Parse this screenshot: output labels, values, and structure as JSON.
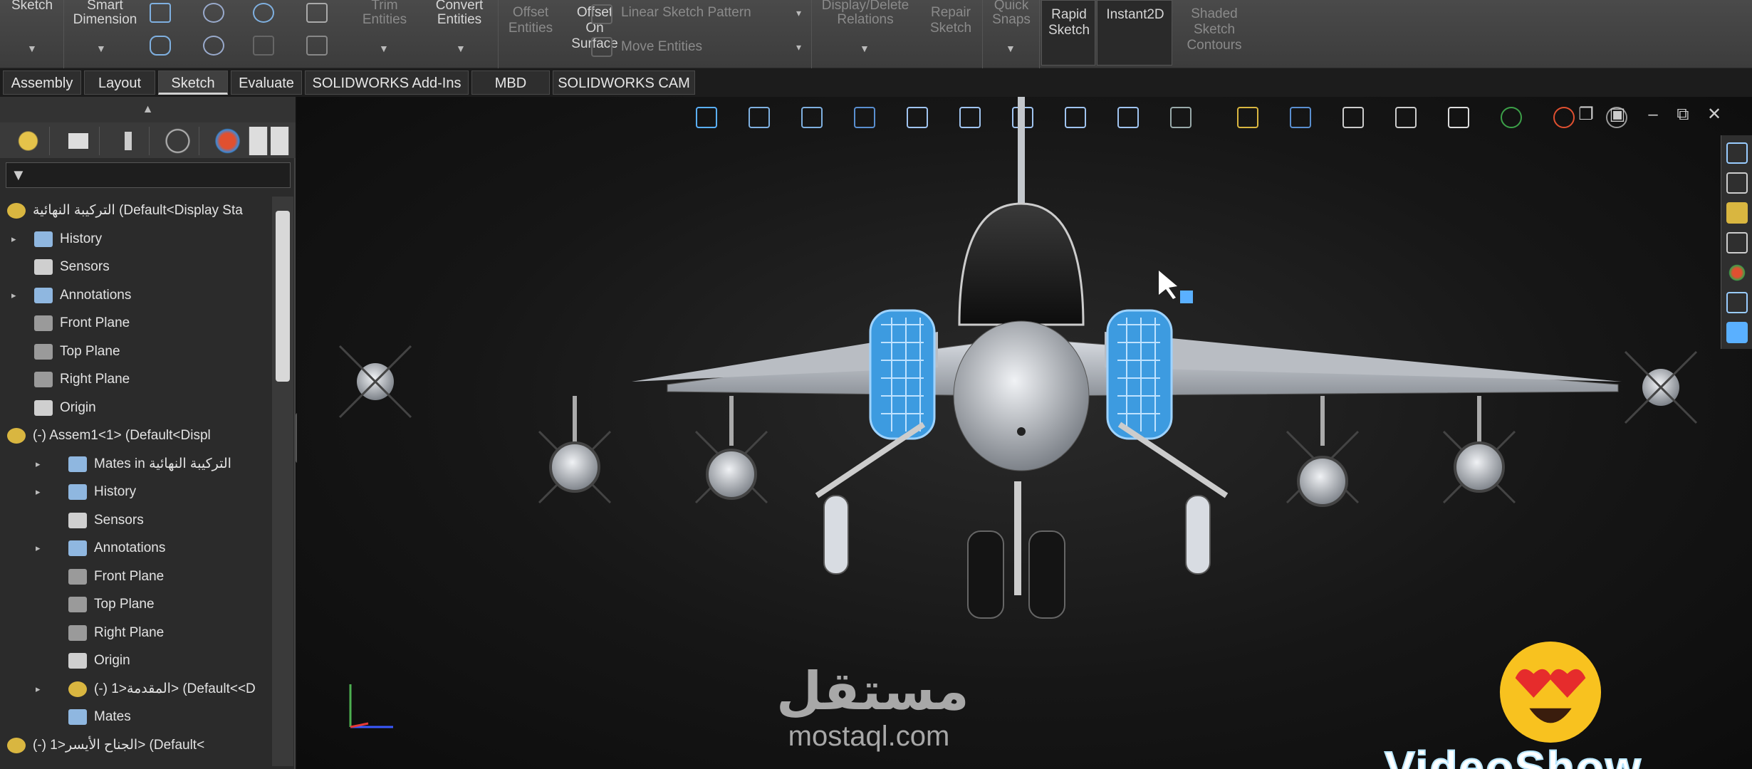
{
  "ribbon": {
    "groups": [
      {
        "label_1": "Sketch",
        "label_2": ""
      },
      {
        "label_1": "Smart",
        "label_2": "Dimension"
      },
      {
        "label_1": "Trim",
        "label_2": "Entities"
      },
      {
        "label_1": "Convert",
        "label_2": "Entities"
      },
      {
        "label_1": "Offset",
        "label_2": "Entities"
      },
      {
        "label_1": "Offset",
        "label_2": "On",
        "label_3": "Surface"
      }
    ],
    "linear_sketch_pattern": "Linear Sketch Pattern",
    "move_entities": "Move Entities",
    "display_delete_relations": "Display/Delete",
    "relations": "Relations",
    "repair_sketch_1": "Repair",
    "repair_sketch_2": "Sketch",
    "quick_snaps_1": "Quick",
    "quick_snaps_2": "Snaps",
    "rapid_sketch_1": "Rapid",
    "rapid_sketch_2": "Sketch",
    "instant2d": "Instant2D",
    "shaded_1": "Shaded",
    "shaded_2": "Sketch",
    "shaded_3": "Contours"
  },
  "tabs": [
    "Assembly",
    "Layout",
    "Sketch",
    "Evaluate",
    "SOLIDWORKS Add-Ins",
    "MBD",
    "SOLIDWORKS CAM"
  ],
  "active_tab": "Sketch",
  "panel": {
    "collapse_glyph": "▲",
    "tree": [
      {
        "indent": 0,
        "expander": "",
        "icon": "assembly-icon",
        "label": "التركيبة النهائية (Default<Display Sta",
        "color": "#d9b640"
      },
      {
        "indent": 1,
        "expander": "▸",
        "icon": "history-icon",
        "label": "History",
        "color": "#8fb7e0"
      },
      {
        "indent": 1,
        "expander": "",
        "icon": "sensors-icon",
        "label": "Sensors",
        "color": "#cfcfcf"
      },
      {
        "indent": 1,
        "expander": "▸",
        "icon": "annotations-icon",
        "label": "Annotations",
        "color": "#8fb7e0"
      },
      {
        "indent": 1,
        "expander": "",
        "icon": "plane-icon",
        "label": "Front Plane",
        "color": "#9a9a9a"
      },
      {
        "indent": 1,
        "expander": "",
        "icon": "plane-icon",
        "label": "Top Plane",
        "color": "#9a9a9a"
      },
      {
        "indent": 1,
        "expander": "",
        "icon": "plane-icon",
        "label": "Right Plane",
        "color": "#9a9a9a"
      },
      {
        "indent": 1,
        "expander": "",
        "icon": "origin-icon",
        "label": "Origin",
        "color": "#cfcfcf"
      },
      {
        "indent": 0,
        "expander": "▾",
        "icon": "subassembly-icon",
        "label": "(-) Assem1<1> (Default<Displ",
        "color": "#d9b640"
      },
      {
        "indent": 2,
        "expander": "▸",
        "icon": "mates-icon",
        "label": "Mates in التركيبة النهائية",
        "color": "#8fb7e0"
      },
      {
        "indent": 2,
        "expander": "▸",
        "icon": "history-icon",
        "label": "History",
        "color": "#8fb7e0"
      },
      {
        "indent": 2,
        "expander": "",
        "icon": "sensors-icon",
        "label": "Sensors",
        "color": "#cfcfcf"
      },
      {
        "indent": 2,
        "expander": "▸",
        "icon": "annotations-icon",
        "label": "Annotations",
        "color": "#8fb7e0"
      },
      {
        "indent": 2,
        "expander": "",
        "icon": "plane-icon",
        "label": "Front Plane",
        "color": "#9a9a9a"
      },
      {
        "indent": 2,
        "expander": "",
        "icon": "plane-icon",
        "label": "Top Plane",
        "color": "#9a9a9a"
      },
      {
        "indent": 2,
        "expander": "",
        "icon": "plane-icon",
        "label": "Right Plane",
        "color": "#9a9a9a"
      },
      {
        "indent": 2,
        "expander": "",
        "icon": "origin-icon",
        "label": "Origin",
        "color": "#cfcfcf"
      },
      {
        "indent": 2,
        "expander": "▸",
        "icon": "part-icon",
        "label": "(-) المقدمة<1> (Default<<D",
        "color": "#d9b640"
      },
      {
        "indent": 2,
        "expander": "",
        "icon": "mates-icon",
        "label": "Mates",
        "color": "#8fb7e0"
      },
      {
        "indent": 0,
        "expander": "▾",
        "icon": "subassembly-icon",
        "label": "(-) الجناح الأيسر<1> (Default<",
        "color": "#d9b640"
      }
    ]
  },
  "window_controls": [
    "❐",
    "▣",
    "–",
    "⧉",
    "✕"
  ],
  "watermark": {
    "arabic": "مستقل",
    "latin": "mostaql.com"
  },
  "overlay_text": "VideoShow",
  "colors": {
    "accent_blue": "#3d9be0",
    "jet_body": "#c9cdd3",
    "viewport_bg": "#161616"
  }
}
